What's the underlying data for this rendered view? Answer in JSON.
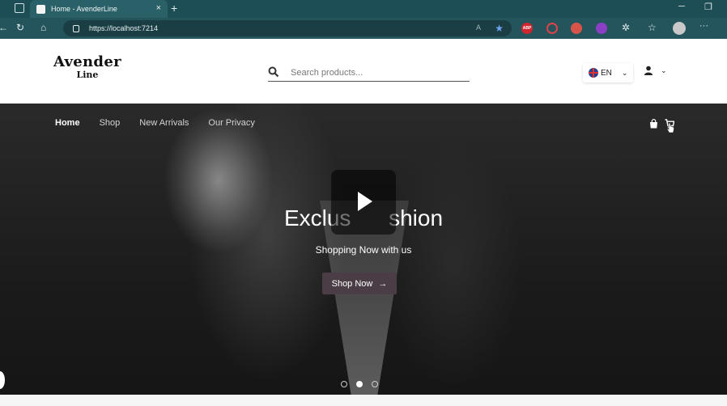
{
  "browser": {
    "tab_title": "Home - AvenderLine",
    "tab_close_icon": "×",
    "new_tab_icon": "+",
    "url": "https://localhost:7214",
    "minimize_icon": "─",
    "restore_icon": "❐"
  },
  "header": {
    "logo_line1": "Avender",
    "logo_line2": "Line",
    "search_placeholder": "Search products...",
    "language": "EN"
  },
  "nav": {
    "items": [
      "Home",
      "Shop",
      "New Arrivals",
      "Our Privacy"
    ]
  },
  "hero": {
    "headline": "Exclus      shion",
    "subheading": "Shopping Now with us",
    "cta_label": "Shop Now",
    "slides_total": 3,
    "active_slide": 2
  },
  "colors": {
    "browser_tabbar": "#1d4d55",
    "address_bar": "#24545c",
    "cta_button": "#4a3d45"
  }
}
